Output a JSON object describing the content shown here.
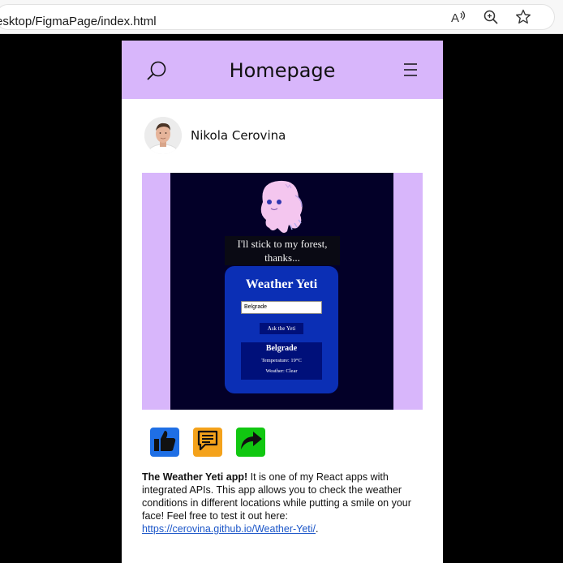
{
  "browser": {
    "address": "esktop/FigmaPage/index.html",
    "icons": [
      "read-aloud-icon",
      "zoom-icon",
      "favorite-star-icon"
    ]
  },
  "header": {
    "title": "Homepage",
    "left_icon": "search-icon",
    "right_icon": "menu-icon",
    "color": "#d8b6fb"
  },
  "profile": {
    "name": "Nikola Cerovina"
  },
  "app_preview": {
    "quote": "I'll stick to my forest, thanks...",
    "title": "Weather Yeti",
    "input_value": "Belgrade",
    "button": "Ask the Yeti",
    "result_city": "Belgrade",
    "temperature": "Temperature: 19°C",
    "weather": "Weather: Clear"
  },
  "actions": [
    {
      "icon": "thumbs-up-icon",
      "color": "#1f6fe5"
    },
    {
      "icon": "comment-icon",
      "color": "#f4a21b"
    },
    {
      "icon": "share-icon",
      "color": "#11c711"
    }
  ],
  "post": {
    "title": "The Weather Yeti app!",
    "body": " It is one of my React apps with integrated APIs. This app allows you to check the weather conditions in different locations while putting a smile on your face! Feel free to test it out here: ",
    "link": "https://cerovina.github.io/Weather-Yeti/",
    "end": "."
  }
}
